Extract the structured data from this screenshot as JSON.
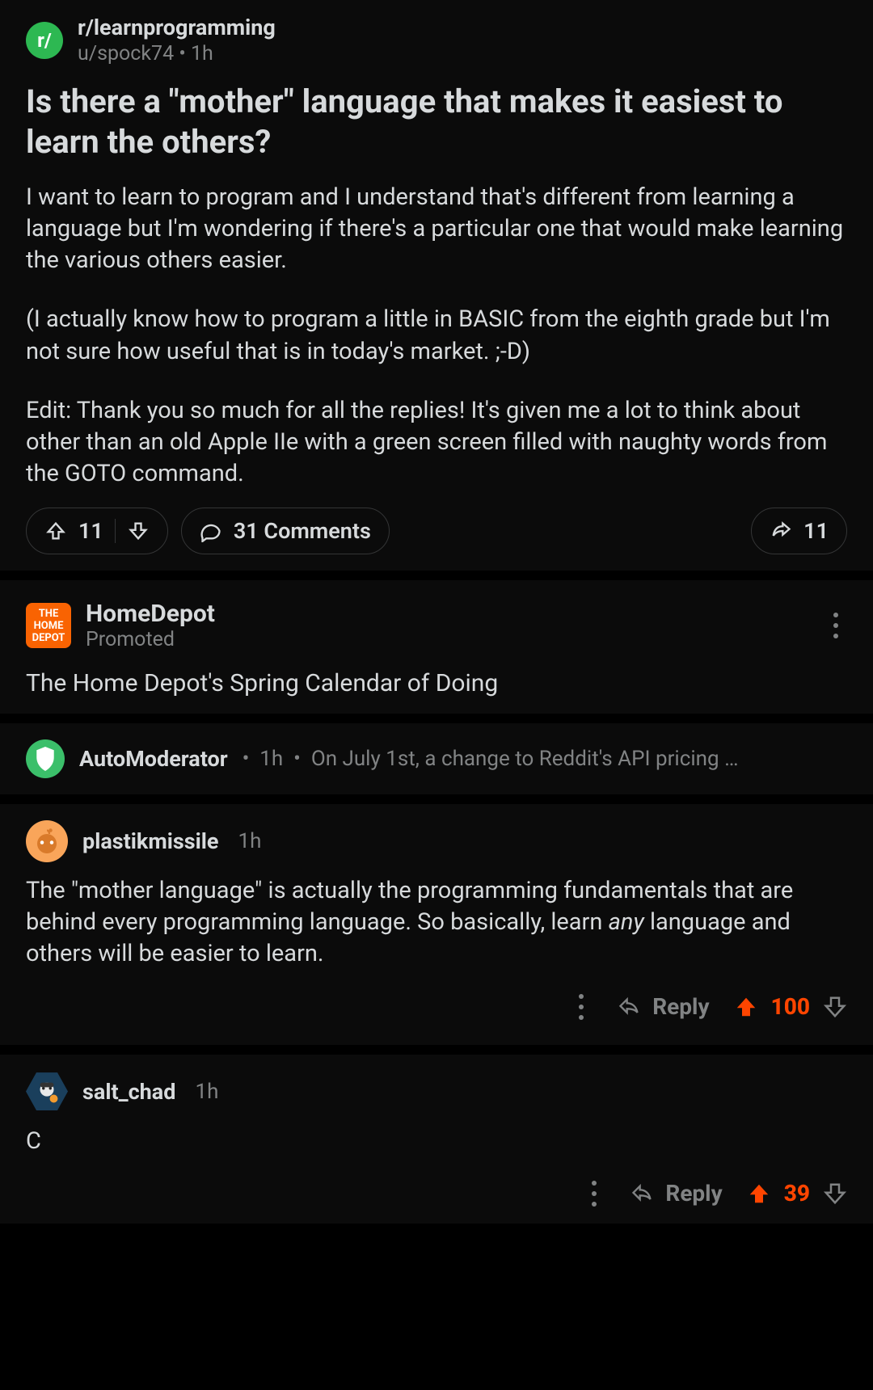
{
  "post": {
    "subreddit": "r/learnprogramming",
    "author": "u/spock74",
    "time": "1h",
    "title": "Is there a \"mother\" language that makes it easiest to learn the others?",
    "body_p1": "I want to learn to program and I understand that's different from learning a language but I'm wondering if there's a particular one that would make learning the various others easier.",
    "body_p2": "(I actually know how to program a little in BASIC from the eighth grade but I'm not sure how useful that is in today's market. ;-D)",
    "body_p3": "Edit: Thank you so much for all the replies! It's given me a lot to think about other than an old Apple IIe with a green screen filled with naughty words from the GOTO command.",
    "score": "11",
    "comments": "31 Comments",
    "share": "11"
  },
  "promo": {
    "name": "HomeDepot",
    "tag": "Promoted",
    "text": "The Home Depot's Spring Calendar of Doing"
  },
  "automod": {
    "name": "AutoModerator",
    "time": "1h",
    "preview": "On July 1st, a change to Reddit's API pricing …"
  },
  "comments": [
    {
      "user": "plastikmissile",
      "time": "1h",
      "body_pre": "The \"mother language\" is actually the programming fundamentals that are behind every programming language. So basically, learn ",
      "body_em": "any",
      "body_post": " language and others will be easier to learn.",
      "reply": "Reply",
      "score": "100"
    },
    {
      "user": "salt_chad",
      "time": "1h",
      "body": "C",
      "reply": "Reply",
      "score": "39"
    }
  ]
}
